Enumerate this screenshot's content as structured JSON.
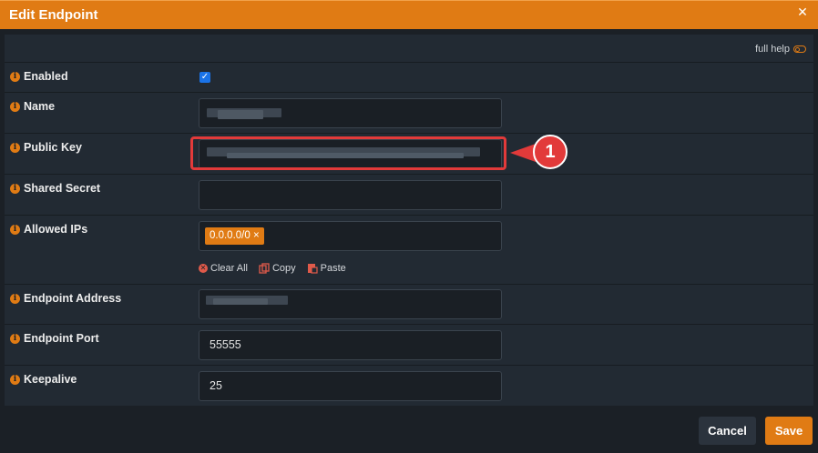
{
  "dialog": {
    "title": "Edit Endpoint",
    "full_help_label": "full help"
  },
  "fields": {
    "enabled": {
      "label": "Enabled",
      "checked": true
    },
    "name": {
      "label": "Name"
    },
    "public_key": {
      "label": "Public Key"
    },
    "shared_secret": {
      "label": "Shared Secret",
      "value": ""
    },
    "allowed_ips": {
      "label": "Allowed IPs",
      "tags": [
        "0.0.0.0/0"
      ]
    },
    "endpoint_address": {
      "label": "Endpoint Address"
    },
    "endpoint_port": {
      "label": "Endpoint Port",
      "value": "55555"
    },
    "keepalive": {
      "label": "Keepalive",
      "value": "25"
    }
  },
  "ip_actions": {
    "clear_all": "Clear All",
    "copy": "Copy",
    "paste": "Paste"
  },
  "annotation": {
    "number": "1"
  },
  "buttons": {
    "cancel": "Cancel",
    "save": "Save"
  },
  "colors": {
    "accent": "#e07b14",
    "callout": "#e23a3a",
    "background": "#1b2026",
    "panel": "#222a33"
  },
  "icons": {
    "info": "info-icon",
    "close": "close-icon",
    "clear": "x-circle-icon",
    "copy": "copy-icon",
    "paste": "paste-icon",
    "toggle": "toggle-icon"
  }
}
